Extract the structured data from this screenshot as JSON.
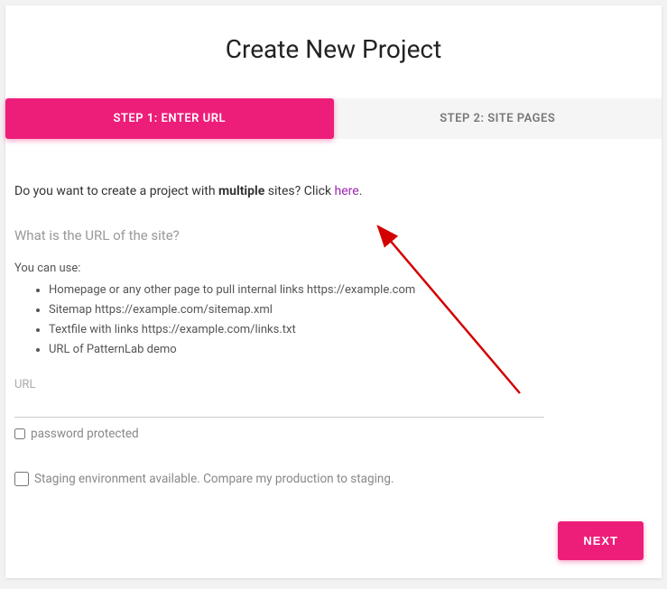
{
  "title": "Create New Project",
  "tabs": {
    "step1": "STEP 1: ENTER URL",
    "step2": "STEP 2: SITE PAGES"
  },
  "prompt": {
    "prefix": "Do you want to create a project with ",
    "bold": "multiple",
    "suffix": " sites? Click ",
    "link": "here",
    "end": "."
  },
  "question": "What is the URL of the site?",
  "youcanuse": "You can use:",
  "bullets": [
    "Homepage or any other page to pull internal links https://example.com",
    "Sitemap https://example.com/sitemap.xml",
    "Textfile with links https://example.com/links.txt",
    "URL of PatternLab demo"
  ],
  "urlLabel": "URL",
  "passwordProtected": "password protected",
  "stagingLabel": "Staging environment available. Compare my production to staging.",
  "nextBtn": "NEXT"
}
